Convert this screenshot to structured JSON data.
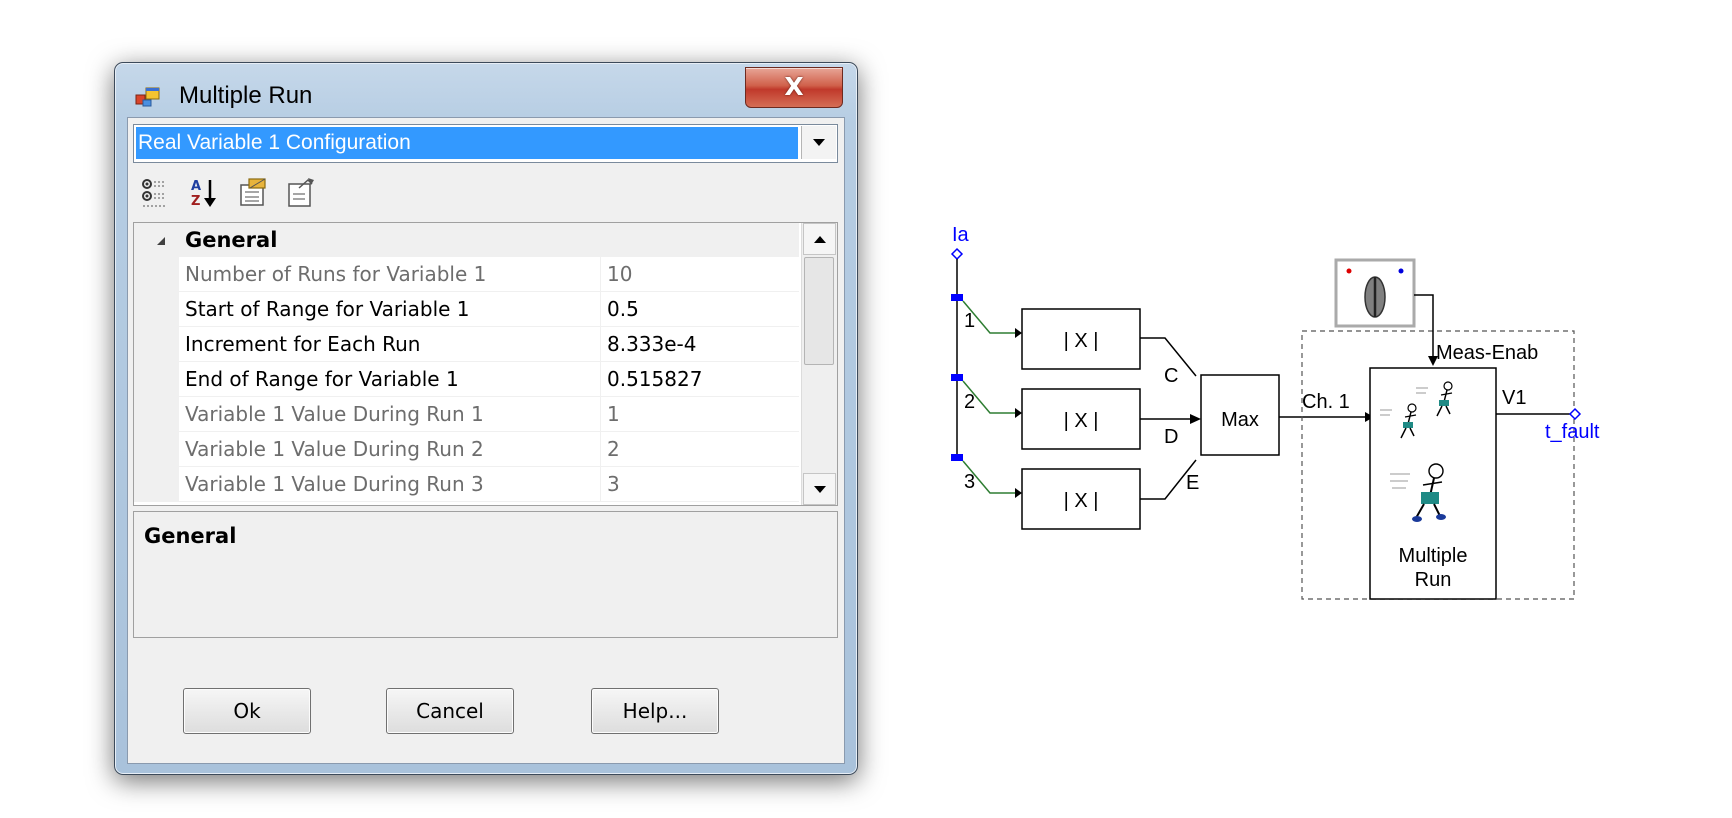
{
  "dialog": {
    "title": "Multiple Run",
    "close_label": "X",
    "combo": {
      "selected": "Real Variable 1 Configuration"
    },
    "toolbar": {
      "icons": [
        "categorized-icon",
        "alphabetical-sort-icon",
        "property-pages-icon",
        "events-icon"
      ]
    },
    "grid": {
      "category": "General",
      "rows": [
        {
          "name": "Number of Runs for Variable 1",
          "value": "10",
          "readonly": true
        },
        {
          "name": "Start of Range for Variable 1",
          "value": "0.5",
          "readonly": false
        },
        {
          "name": "Increment for Each Run",
          "value": "8.333e-4",
          "readonly": false
        },
        {
          "name": "End of Range for Variable 1",
          "value": "0.515827",
          "readonly": false
        },
        {
          "name": "Variable 1 Value During Run 1",
          "value": "1",
          "readonly": true
        },
        {
          "name": "Variable 1 Value During Run 2",
          "value": "2",
          "readonly": true
        },
        {
          "name": "Variable 1 Value During Run 3",
          "value": "3",
          "readonly": true
        }
      ]
    },
    "description": {
      "title": "General",
      "text": ""
    },
    "buttons": {
      "ok": "Ok",
      "cancel": "Cancel",
      "help": "Help..."
    }
  },
  "diagram": {
    "input_label": "Ia",
    "channel_numbers": [
      "1",
      "2",
      "3"
    ],
    "abs_blocks": [
      "| X |",
      "| X |",
      "| X |"
    ],
    "max_inputs": [
      "C",
      "D",
      "E"
    ],
    "max_label": "Max",
    "channel_label": "Ch. 1",
    "enable_label": "Meas-Enab",
    "output_label": "V1",
    "output_signal": "t_fault",
    "multirun_label_line1": "Multiple",
    "multirun_label_line2": "Run",
    "colors": {
      "signal_label": "#0000ff",
      "wire": "#000000",
      "green_wire": "#2e7d32",
      "node": "#0000ff"
    }
  }
}
